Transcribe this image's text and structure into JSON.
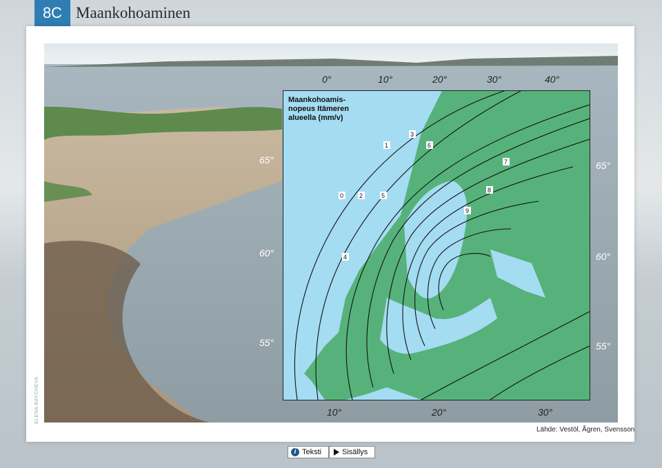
{
  "header": {
    "badge": "8C",
    "title": "Maankohoaminen"
  },
  "photo": {
    "credit": "ELENA BAYCHEVA"
  },
  "map": {
    "title_lines": [
      "Maankohoamis-",
      "nopeus Itämeren",
      "alueella (mm/v)"
    ],
    "top_longitudes": [
      "0°",
      "10°",
      "20°",
      "30°",
      "40°"
    ],
    "bottom_longitudes": [
      "10°",
      "20°",
      "30°"
    ],
    "left_latitudes": [
      "65°",
      "60°",
      "55°"
    ],
    "right_latitudes": [
      "65°",
      "60°",
      "55°"
    ],
    "isolines": [
      "0",
      "1",
      "2",
      "3",
      "4",
      "5",
      "6",
      "7",
      "8",
      "9"
    ],
    "colors": {
      "sea": "#a4dcf2",
      "land": "#56b27a",
      "line": "#111111"
    }
  },
  "source": "Lähde: Vestöl, Ågren, Svensson",
  "nav": {
    "text_label": "Teksti",
    "contents_label": "Sisällys"
  }
}
